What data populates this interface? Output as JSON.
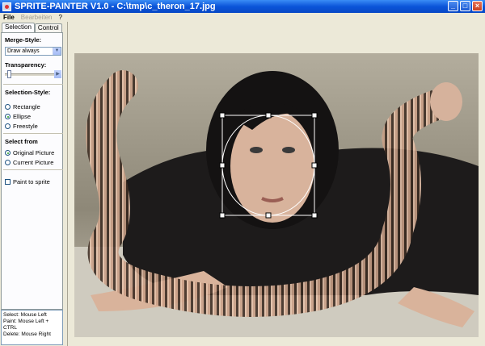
{
  "window": {
    "title": "SPRITE-PAINTER V1.0 - C:\\tmp\\c_theron_17.jpg",
    "buttons": {
      "minimize": "_",
      "maximize": "□",
      "close": "×"
    }
  },
  "menu": {
    "file": "File",
    "edit": "Bearbeiten",
    "help": "?"
  },
  "tabs": {
    "selection": "Selection",
    "control": "Control"
  },
  "panel": {
    "merge_label": "Merge-Style:",
    "merge_value": "Draw always",
    "transparency_label": "Transparency:",
    "transparency_value": 0.05,
    "selection_style_label": "Selection-Style:",
    "rectangle": "Rectangle",
    "ellipse": "Ellipse",
    "freestyle": "Freestyle",
    "select_from_label": "Select from",
    "original_picture": "Original Picture",
    "current_picture": "Current Picture",
    "paint_to_sprite": "Paint to sprite"
  },
  "help": {
    "line1": "Select: Mouse Left",
    "line2": "Paint: Mouse Left + CTRL",
    "line3": "Delete: Mouse Right"
  },
  "colors": {
    "titlebar": "#0b55d9",
    "panel_bg": "#ece9d8"
  }
}
